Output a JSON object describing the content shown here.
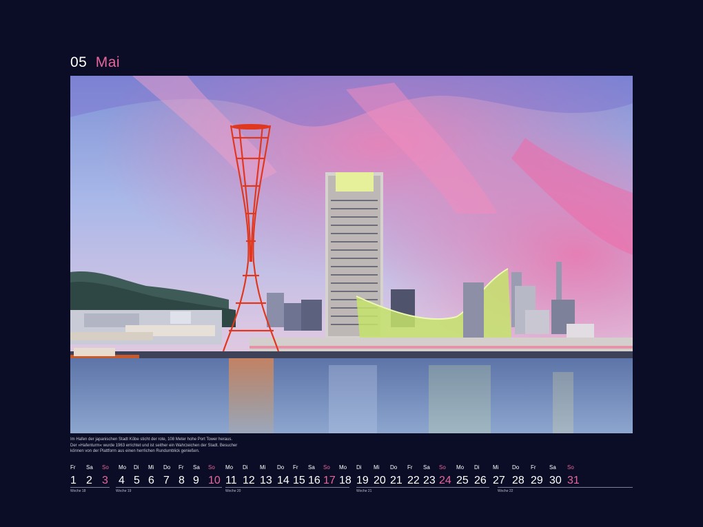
{
  "header": {
    "month_number": "05",
    "month_name": "Mai"
  },
  "caption": [
    "Im Hafen der japanischen Stadt Kōbe sticht der rote, 108 Meter hohe Port Tower heraus.",
    "Der »Hafenturm« wurde 1963 errichtet und ist seither ein Wahrzeichen der Stadt. Besucher",
    "können von der Plattform aus einen herrlichen Rundumblick genießen."
  ],
  "weeks": [
    {
      "label": "Woche 18",
      "days": [
        {
          "name": "Fr",
          "date": "1"
        },
        {
          "name": "Sa",
          "date": "2"
        },
        {
          "name": "So",
          "date": "3",
          "sunday": true
        }
      ]
    },
    {
      "label": "Woche 19",
      "days": [
        {
          "name": "Mo",
          "date": "4"
        },
        {
          "name": "Di",
          "date": "5"
        },
        {
          "name": "Mi",
          "date": "6"
        },
        {
          "name": "Do",
          "date": "7"
        },
        {
          "name": "Fr",
          "date": "8"
        },
        {
          "name": "Sa",
          "date": "9"
        },
        {
          "name": "So",
          "date": "10",
          "sunday": true
        }
      ]
    },
    {
      "label": "Woche 20",
      "days": [
        {
          "name": "Mo",
          "date": "11"
        },
        {
          "name": "Di",
          "date": "12"
        },
        {
          "name": "Mi",
          "date": "13"
        },
        {
          "name": "Do",
          "date": "14"
        },
        {
          "name": "Fr",
          "date": "15"
        },
        {
          "name": "Sa",
          "date": "16"
        },
        {
          "name": "So",
          "date": "17",
          "sunday": true
        }
      ]
    },
    {
      "label": "Woche 21",
      "days": [
        {
          "name": "Mo",
          "date": "18"
        },
        {
          "name": "Di",
          "date": "19"
        },
        {
          "name": "Mi",
          "date": "20"
        },
        {
          "name": "Do",
          "date": "21"
        },
        {
          "name": "Fr",
          "date": "22"
        },
        {
          "name": "Sa",
          "date": "23"
        },
        {
          "name": "So",
          "date": "24",
          "sunday": true
        }
      ]
    },
    {
      "label": "Woche 22",
      "days": [
        {
          "name": "Mo",
          "date": "25"
        },
        {
          "name": "Di",
          "date": "26"
        },
        {
          "name": "Mi",
          "date": "27"
        },
        {
          "name": "Do",
          "date": "28"
        },
        {
          "name": "Fr",
          "date": "29"
        },
        {
          "name": "Sa",
          "date": "30"
        },
        {
          "name": "So",
          "date": "31",
          "sunday": true
        }
      ]
    }
  ],
  "colors": {
    "background": "#0b0d26",
    "accent": "#e8669c",
    "text": "#ffffff"
  }
}
